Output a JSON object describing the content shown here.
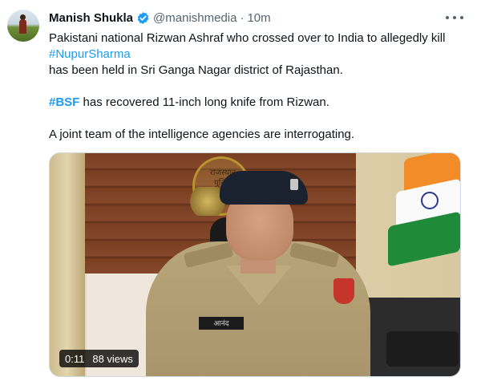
{
  "tweet": {
    "author_name": "Manish Shukla",
    "handle": "@manishmedia",
    "separator": "·",
    "time": "10m",
    "text": {
      "line1": "Pakistani national Rizwan Ashraf who crossed over to India to allegedly kill",
      "hashtag1": "#NupurSharma",
      "line3": "has been held in Sri Ganga Nagar district of  Rajasthan.",
      "hashtag2": "#BSF",
      "line4_rest": " has recovered 11-inch long knife from Rizwan.",
      "line5": "A joint team of the intelligence agencies are interrogating."
    },
    "media": {
      "duration": "0:11",
      "views": "88 views",
      "crest_text": "राजस्थान पुलिस",
      "nametag": "आनंद"
    }
  },
  "colors": {
    "accent": "#1d9bf0",
    "text": "#0f1419",
    "secondary": "#536471"
  },
  "icons": {
    "verified": "verified-badge-icon",
    "more": "more-options-icon"
  }
}
